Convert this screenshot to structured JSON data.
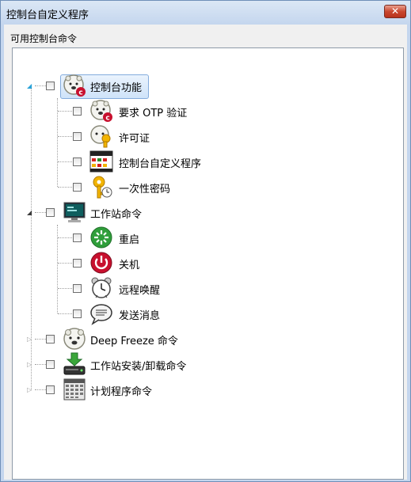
{
  "window": {
    "title": "控制台自定义程序",
    "close_glyph": "✕"
  },
  "group": {
    "label": "可用控制台命令"
  },
  "tree": {
    "nodes": [
      {
        "label": "控制台功能",
        "expanded": true,
        "selected": true,
        "icon": "console-features-icon",
        "children": [
          {
            "label": "要求 OTP 验证",
            "icon": "otp-bear-icon"
          },
          {
            "label": "许可证",
            "icon": "license-key-icon"
          },
          {
            "label": "控制台自定义程序",
            "icon": "console-customizer-icon"
          },
          {
            "label": "一次性密码",
            "icon": "one-time-password-icon"
          }
        ]
      },
      {
        "label": "工作站命令",
        "expanded": true,
        "icon": "workstation-monitor-icon",
        "children": [
          {
            "label": "重启",
            "icon": "restart-icon"
          },
          {
            "label": "关机",
            "icon": "shutdown-icon"
          },
          {
            "label": "远程唤醒",
            "icon": "alarm-clock-icon"
          },
          {
            "label": "发送消息",
            "icon": "message-bubble-icon"
          }
        ]
      },
      {
        "label": "Deep Freeze 命令",
        "expanded": false,
        "icon": "deep-freeze-bear-icon"
      },
      {
        "label": "工作站安装/卸载命令",
        "expanded": false,
        "icon": "install-drive-icon"
      },
      {
        "label": "计划程序命令",
        "expanded": false,
        "icon": "calendar-icon"
      }
    ]
  }
}
